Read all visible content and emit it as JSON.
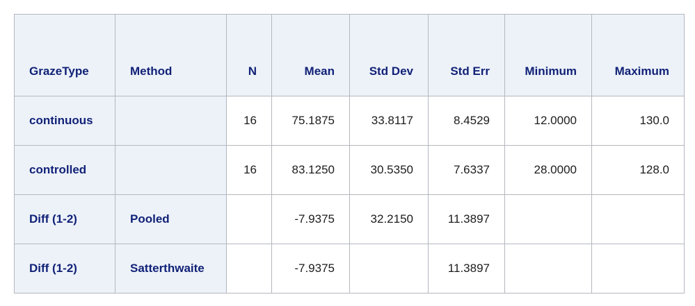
{
  "table": {
    "columns": [
      "GrazeType",
      "Method",
      "N",
      "Mean",
      "Std Dev",
      "Std Err",
      "Minimum",
      "Maximum"
    ],
    "rows": [
      [
        "continuous",
        "",
        "16",
        "75.1875",
        "33.8117",
        "8.4529",
        "12.0000",
        "130.0"
      ],
      [
        "controlled",
        "",
        "16",
        "83.1250",
        "30.5350",
        "7.6337",
        "28.0000",
        "128.0"
      ],
      [
        "Diff (1-2)",
        "Pooled",
        "",
        "-7.9375",
        "32.2150",
        "11.3897",
        "",
        ""
      ],
      [
        "Diff (1-2)",
        "Satterthwaite",
        "",
        "-7.9375",
        "",
        "11.3897",
        "",
        ""
      ]
    ]
  }
}
